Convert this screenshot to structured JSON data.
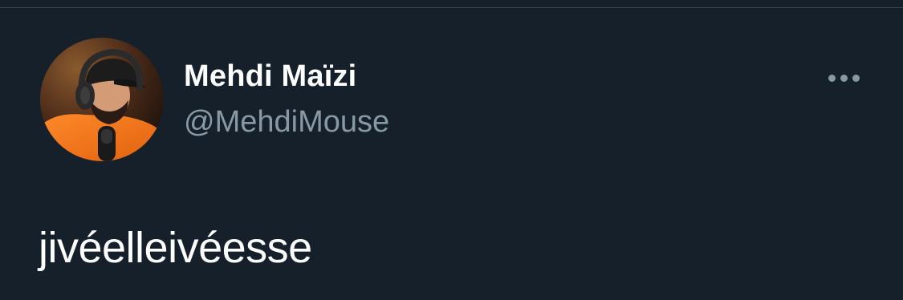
{
  "tweet": {
    "author": {
      "display_name": "Mehdi Maïzi",
      "handle": "@MehdiMouse",
      "avatar_icon": "profile-photo"
    },
    "text": "jivéelleivéesse",
    "more_icon": "more-horizontal-icon"
  },
  "colors": {
    "background": "#15202b",
    "primary_text": "#ffffff",
    "secondary_text": "#8899a6",
    "divider": "#38444d"
  }
}
